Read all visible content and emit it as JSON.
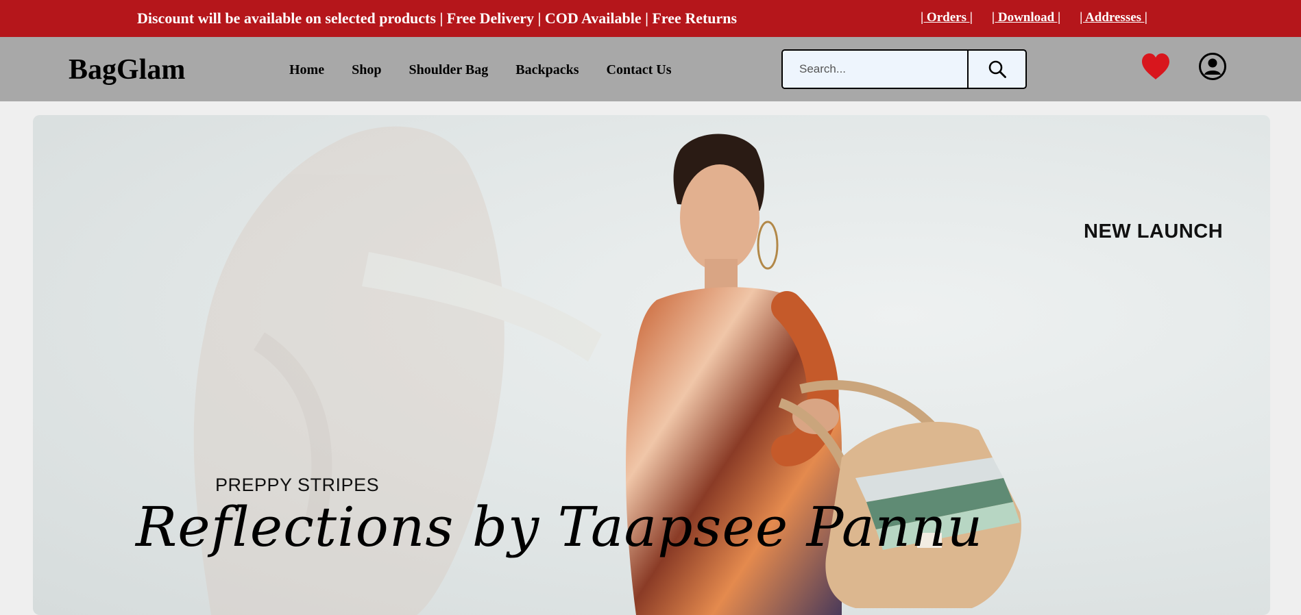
{
  "topbar": {
    "promo_text": "Discount will be available on selected products | Free Delivery | COD Available | Free Returns",
    "links": [
      "| Orders |",
      "| Download |",
      "| Addresses |"
    ]
  },
  "header": {
    "brand": "BagGlam",
    "nav": [
      "Home",
      "Shop",
      "Shoulder Bag",
      "Backpacks",
      "Contact Us"
    ],
    "search": {
      "placeholder": "Search...",
      "value": ""
    },
    "icons": [
      "search-icon",
      "heart-icon",
      "user-icon"
    ]
  },
  "hero": {
    "badge": "NEW LAUNCH",
    "eyebrow": "PREPPY STRIPES",
    "script_title": "Reflections by Taapsee Pannu"
  },
  "colors": {
    "topbar_bg": "#b5161b",
    "header_bg": "#a8a8a8",
    "heart": "#d8161d",
    "search_bg": "#eef5fd"
  }
}
